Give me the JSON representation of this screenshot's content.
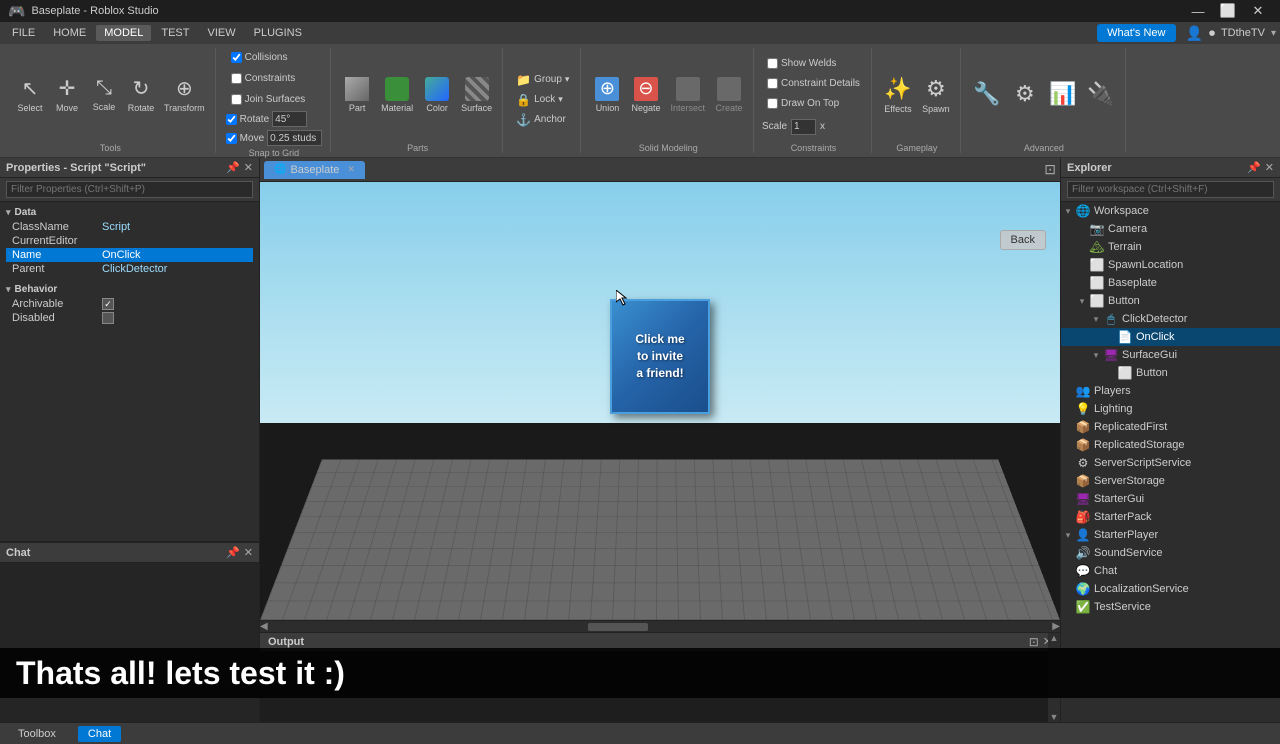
{
  "titlebar": {
    "title": "Baseplate - Roblox Studio",
    "icon": "🎮",
    "controls": [
      "—",
      "⬜",
      "✕"
    ]
  },
  "menubar": {
    "items": [
      "FILE",
      "HOME",
      "MODEL",
      "TEST",
      "VIEW",
      "PLUGINS"
    ]
  },
  "ribbon": {
    "active_tab": "MODEL",
    "tabs": [
      "FILE",
      "HOME",
      "MODEL",
      "TEST",
      "VIEW",
      "PLUGINS"
    ],
    "whats_new": "What's New",
    "tools_group": {
      "label": "Tools",
      "items": [
        "Select",
        "Move",
        "Scale",
        "Rotate",
        "Transform"
      ]
    },
    "snap_group": {
      "label": "Snap to Grid",
      "rotate_label": "Rotate",
      "rotate_value": "45°",
      "move_label": "Move",
      "move_value": "0.25 studs",
      "collisions": "Collisions",
      "constraints": "Constraints",
      "join_surfaces": "Join Surfaces"
    },
    "parts_group": {
      "label": "Parts",
      "items": [
        "Part",
        "Material",
        "Color",
        "Surface"
      ]
    },
    "group_btn": "Group",
    "lock_btn": "Lock",
    "anchor_btn": "Anchor",
    "solid_modeling": {
      "label": "Solid Modeling",
      "union": "Union",
      "negate": "Negate",
      "intersect": "Intersect",
      "create": "Create"
    },
    "gameplay_group": {
      "label": "Gameplay",
      "effects": "Effects",
      "spawn": "Spawn"
    },
    "advanced_group": {
      "label": "Advanced"
    },
    "show_welds": "Show Welds",
    "constraint_details": "Constraint Details",
    "draw_on_top": "Draw On Top",
    "scale_label": "Scale",
    "scale_value": "1",
    "scale_unit": "x",
    "constraints_group": "Constraints"
  },
  "properties_panel": {
    "title": "Properties - Script \"Script\"",
    "filter_placeholder": "Filter Properties (Ctrl+Shift+P)",
    "sections": {
      "data": {
        "label": "Data",
        "rows": [
          {
            "name": "ClassName",
            "value": "Script"
          },
          {
            "name": "CurrentEditor",
            "value": ""
          },
          {
            "name": "Name",
            "value": "OnClick",
            "selected": true
          },
          {
            "name": "Parent",
            "value": "ClickDetector"
          }
        ]
      },
      "behavior": {
        "label": "Behavior",
        "rows": [
          {
            "name": "Archivable",
            "value": "✓",
            "checkbox": true
          },
          {
            "name": "Disabled",
            "value": "",
            "checkbox": true
          }
        ]
      }
    }
  },
  "chat_panel": {
    "title": "Chat"
  },
  "viewport": {
    "tab_label": "Baseplate",
    "back_button": "Back",
    "blue_block_text": "Click me\nto invite\na friend!"
  },
  "output_panel": {
    "title": "Output"
  },
  "explorer": {
    "title": "Explorer",
    "filter_placeholder": "Filter workspace (Ctrl+Shift+F)",
    "tree": [
      {
        "label": "Workspace",
        "indent": 0,
        "expanded": true,
        "icon": "🌐",
        "color": "#4fc3f7"
      },
      {
        "label": "Camera",
        "indent": 1,
        "expanded": false,
        "icon": "📷",
        "color": "#ccc"
      },
      {
        "label": "Terrain",
        "indent": 1,
        "expanded": false,
        "icon": "🏔",
        "color": "#8bc34a"
      },
      {
        "label": "SpawnLocation",
        "indent": 1,
        "expanded": false,
        "icon": "⬜",
        "color": "#ff9800"
      },
      {
        "label": "Baseplate",
        "indent": 1,
        "expanded": false,
        "icon": "⬜",
        "color": "#4fc3f7"
      },
      {
        "label": "Button",
        "indent": 1,
        "expanded": true,
        "icon": "⬜",
        "color": "#ff9800"
      },
      {
        "label": "ClickDetector",
        "indent": 2,
        "expanded": true,
        "icon": "🖱",
        "color": "#4fc3f7"
      },
      {
        "label": "OnClick",
        "indent": 3,
        "expanded": false,
        "icon": "📄",
        "color": "#4fc3f7",
        "selected": true
      },
      {
        "label": "SurfaceGui",
        "indent": 2,
        "expanded": false,
        "icon": "🖥",
        "color": "#9c27b0"
      },
      {
        "label": "Button",
        "indent": 3,
        "expanded": false,
        "icon": "⬜",
        "color": "#ff9800"
      },
      {
        "label": "Players",
        "indent": 0,
        "expanded": false,
        "icon": "👥",
        "color": "#ff5722"
      },
      {
        "label": "Lighting",
        "indent": 0,
        "expanded": false,
        "icon": "💡",
        "color": "#ffd700"
      },
      {
        "label": "ReplicatedFirst",
        "indent": 0,
        "expanded": false,
        "icon": "📦",
        "color": "#4fc3f7"
      },
      {
        "label": "ReplicatedStorage",
        "indent": 0,
        "expanded": false,
        "icon": "📦",
        "color": "#4fc3f7"
      },
      {
        "label": "ServerScriptService",
        "indent": 0,
        "expanded": false,
        "icon": "⚙",
        "color": "#4fc3f7"
      },
      {
        "label": "ServerStorage",
        "indent": 0,
        "expanded": false,
        "icon": "📦",
        "color": "#4fc3f7"
      },
      {
        "label": "StarterGui",
        "indent": 0,
        "expanded": false,
        "icon": "🖥",
        "color": "#9c27b0"
      },
      {
        "label": "StarterPack",
        "indent": 0,
        "expanded": false,
        "icon": "🎒",
        "color": "#ff9800"
      },
      {
        "label": "StarterPlayer",
        "indent": 0,
        "expanded": true,
        "icon": "👤",
        "color": "#4fc3f7"
      },
      {
        "label": "SoundService",
        "indent": 0,
        "expanded": false,
        "icon": "🔊",
        "color": "#8bc34a"
      },
      {
        "label": "Chat",
        "indent": 0,
        "expanded": false,
        "icon": "💬",
        "color": "#4fc3f7"
      },
      {
        "label": "LocalizationService",
        "indent": 0,
        "expanded": false,
        "icon": "🌍",
        "color": "#4fc3f7"
      },
      {
        "label": "TestService",
        "indent": 0,
        "expanded": false,
        "icon": "✅",
        "color": "#4caf50"
      }
    ]
  },
  "bottom_bar": {
    "tabs": [
      "Toolbox",
      "Chat"
    ]
  },
  "overlay": {
    "text": "Thats all! lets test it :)"
  }
}
